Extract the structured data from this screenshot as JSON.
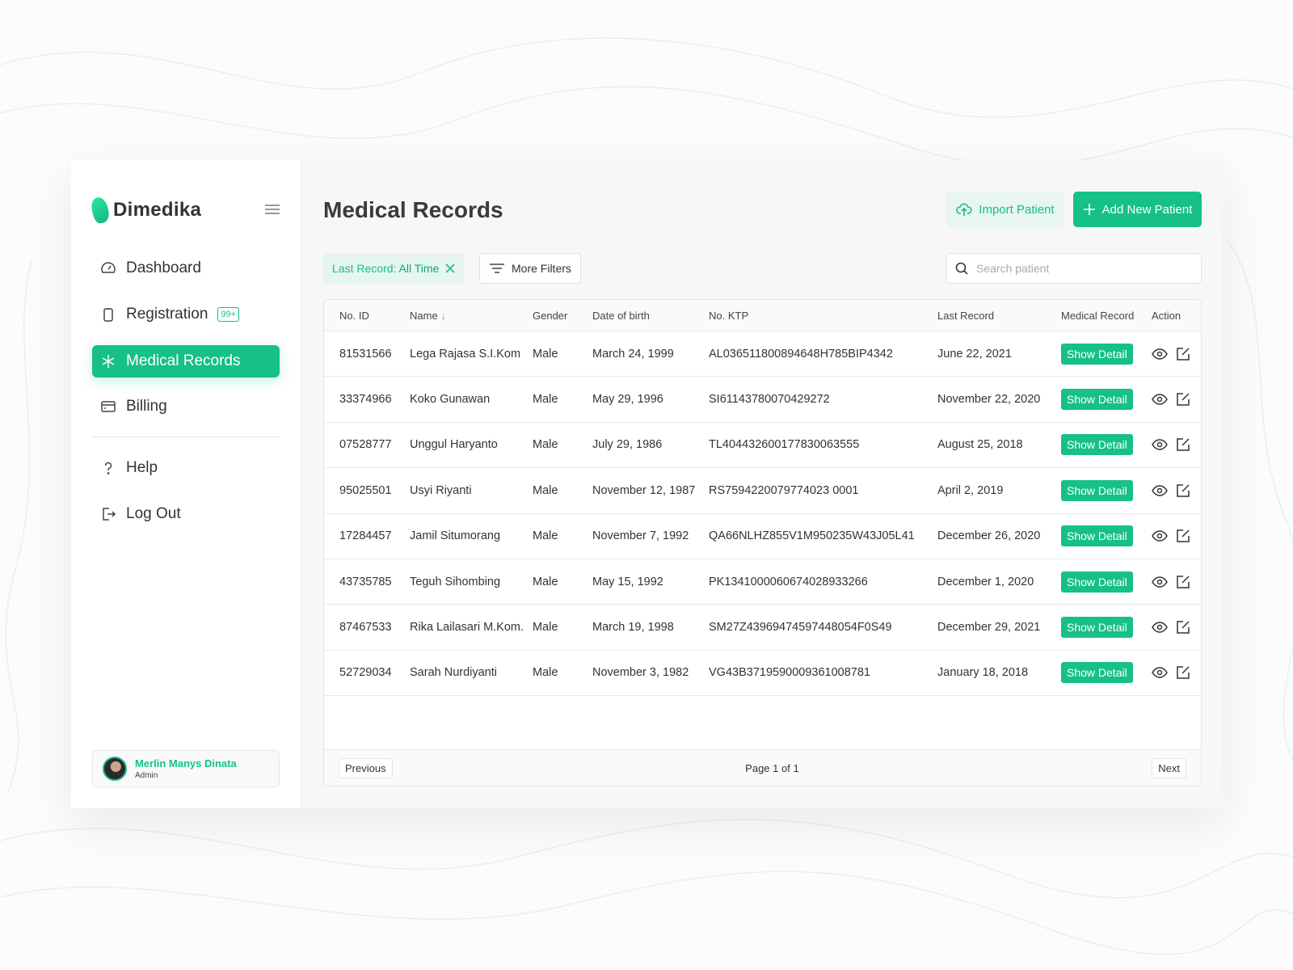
{
  "brand": {
    "name": "Dimedika",
    "accent": "#16c087"
  },
  "sidebar": {
    "items": [
      {
        "label": "Dashboard",
        "icon": "gauge-icon"
      },
      {
        "label": "Registration",
        "icon": "clipboard-icon",
        "badge": "99+"
      },
      {
        "label": "Medical Records",
        "icon": "asterisk-icon",
        "active": true
      },
      {
        "label": "Billing",
        "icon": "card-icon"
      },
      {
        "label": "Help",
        "icon": "question-icon"
      },
      {
        "label": "Log Out",
        "icon": "logout-icon"
      }
    ],
    "user": {
      "name": "Merlin Manys Dinata",
      "role": "Admin"
    }
  },
  "header": {
    "title": "Medical Records",
    "import_label": "Import Patient",
    "add_label": "Add New Patient"
  },
  "filters": {
    "chip_key": "Last Record:",
    "chip_value": "All Time",
    "more_label": "More Filters",
    "search_placeholder": "Search patient"
  },
  "table": {
    "columns": [
      "No. ID",
      "Name",
      "Gender",
      "Date of birth",
      "No. KTP",
      "Last Record",
      "Medical Record",
      "Action"
    ],
    "detail_label": "Show Detail",
    "rows": [
      [
        "81531566",
        "Lega Rajasa S.I.Kom",
        "Male",
        "March 24, 1999",
        "AL036511800894648H785BIP4342",
        "June 22, 2021"
      ],
      [
        "33374966",
        "Koko Gunawan",
        "Male",
        "May 29, 1996",
        "SI61143780070429272",
        "November 22, 2020"
      ],
      [
        "07528777",
        "Unggul Haryanto",
        "Male",
        "July 29, 1986",
        "TL404432600177830063555",
        "August 25, 2018"
      ],
      [
        "95025501",
        "Usyi Riyanti",
        "Male",
        "November 12, 1987",
        "RS7594220079774023 0001",
        "April 2, 2019"
      ],
      [
        "17284457",
        "Jamil Situmorang",
        "Male",
        "November 7, 1992",
        "QA66NLHZ855V1M950235W43J05L41",
        "December 26, 2020"
      ],
      [
        "43735785",
        "Teguh Sihombing",
        "Male",
        "May 15, 1992",
        "PK1341000060674028933266",
        "December 1, 2020"
      ],
      [
        "87467533",
        "Rika Lailasari M.Kom.",
        "Male",
        "March 19, 1998",
        "SM27Z43969474597448054F0S49",
        "December 29, 2021"
      ],
      [
        "52729034",
        "Sarah Nurdiyanti",
        "Male",
        "November 3, 1982",
        "VG43B3719590009361008781",
        "January 18, 2018"
      ]
    ]
  },
  "pagination": {
    "prev": "Previous",
    "page": "Page 1 of 1",
    "next": "Next"
  }
}
